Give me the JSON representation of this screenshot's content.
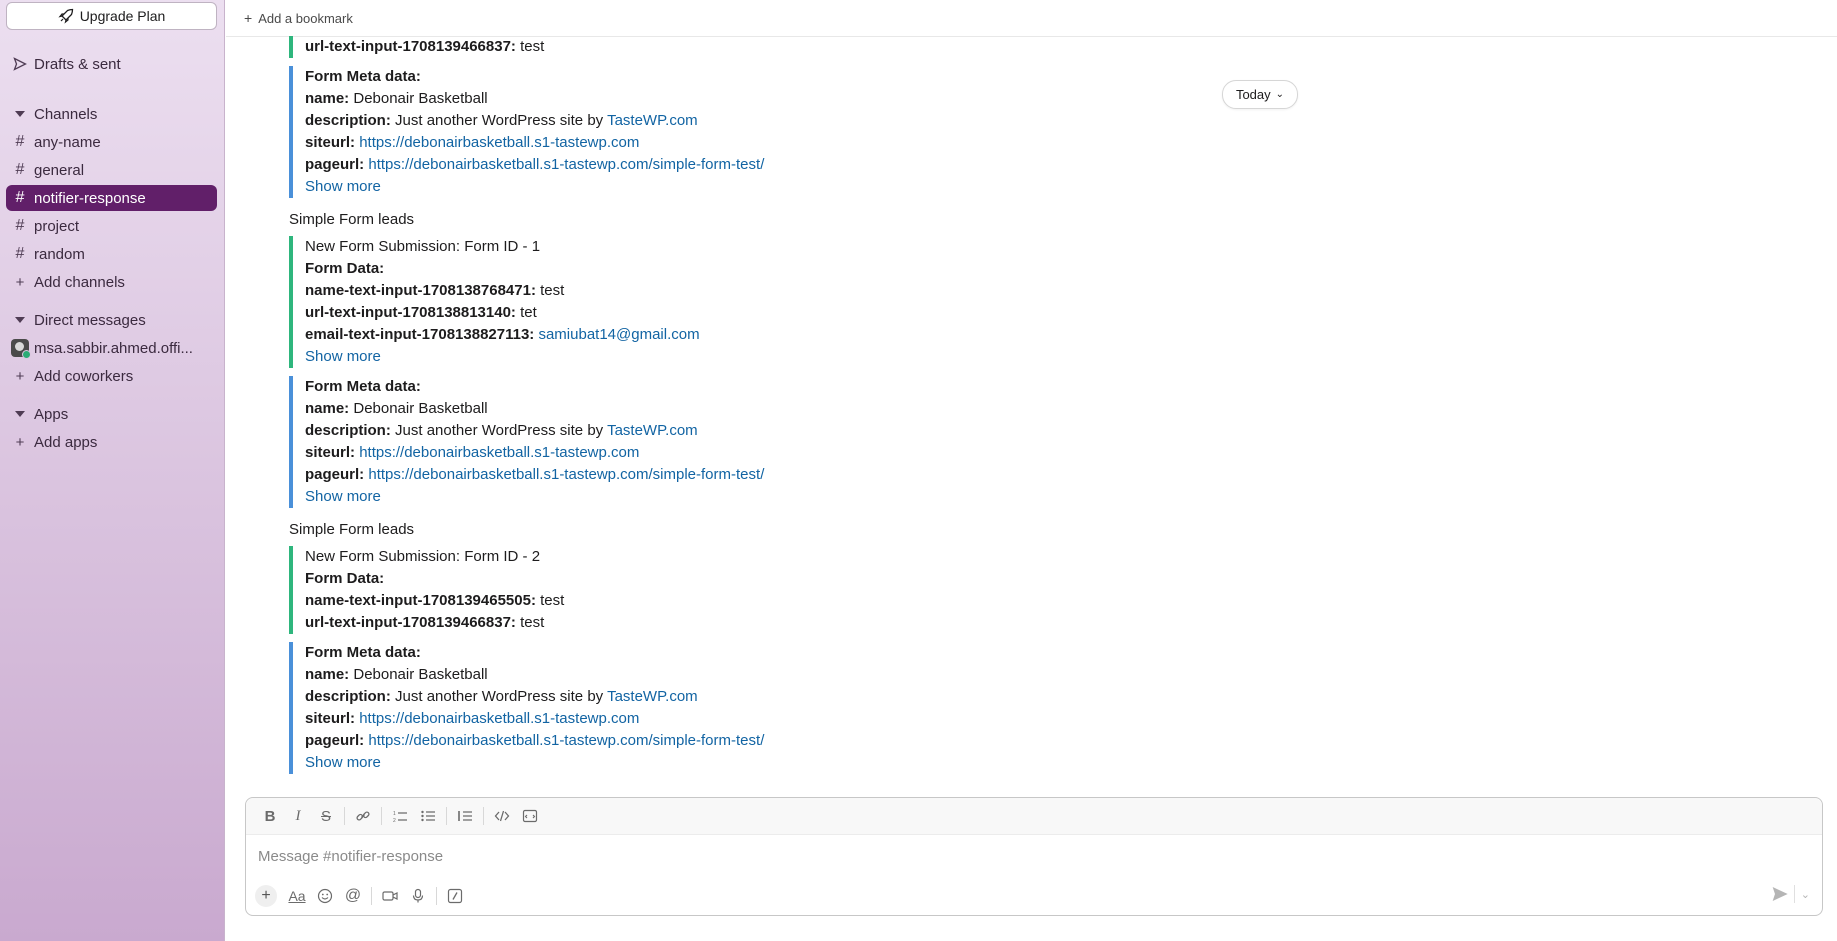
{
  "sidebar": {
    "upgrade_label": "Upgrade Plan",
    "drafts_label": "Drafts & sent",
    "channels_header": "Channels",
    "channels": [
      "any-name",
      "general",
      "notifier-response",
      "project",
      "random"
    ],
    "active_channel": "notifier-response",
    "add_channels": "Add channels",
    "dm_header": "Direct messages",
    "dm_user": "msa.sabbir.ahmed.offi...",
    "add_coworkers": "Add coworkers",
    "apps_header": "Apps",
    "add_apps": "Add apps"
  },
  "topbar": {
    "bookmark_label": "Add a bookmark"
  },
  "date_pill": "Today",
  "messages": {
    "top_partial": {
      "key": "url-text-input-1708139466837:",
      "value": "test"
    },
    "meta_1": {
      "header": "Form Meta data:",
      "name_key": "name:",
      "name_val": "Debonair Basketball",
      "desc_key": "description:",
      "desc_val": "Just another WordPress site by",
      "desc_link": "TasteWP.com",
      "site_key": "siteurl:",
      "site_val": "https://debonairbasketball.s1-tastewp.com",
      "page_key": "pageurl:",
      "page_val": "https://debonairbasketball.s1-tastewp.com/simple-form-test/",
      "show_more": "Show more"
    },
    "post_2": {
      "title": "Simple Form leads",
      "subject": "New Form Submission: Form ID - 1",
      "form_data": "Form Data:",
      "row1_key": "name-text-input-1708138768471:",
      "row1_val": "test",
      "row2_key": "url-text-input-1708138813140:",
      "row2_val": "tet",
      "row3_key": "email-text-input-1708138827113:",
      "row3_val": "samiubat14@gmail.com",
      "show_more": "Show more"
    },
    "meta_2": {
      "header": "Form Meta data:",
      "name_key": "name:",
      "name_val": "Debonair Basketball",
      "desc_key": "description:",
      "desc_val": "Just another WordPress site by",
      "desc_link": "TasteWP.com",
      "site_key": "siteurl:",
      "site_val": "https://debonairbasketball.s1-tastewp.com",
      "page_key": "pageurl:",
      "page_val": "https://debonairbasketball.s1-tastewp.com/simple-form-test/",
      "show_more": "Show more"
    },
    "post_3": {
      "title": "Simple Form leads",
      "subject": "New Form Submission: Form ID - 2",
      "form_data": "Form Data:",
      "row1_key": "name-text-input-1708139465505:",
      "row1_val": "test",
      "row2_key": "url-text-input-1708139466837:",
      "row2_val": "test"
    },
    "meta_3": {
      "header": "Form Meta data:",
      "name_key": "name:",
      "name_val": "Debonair Basketball",
      "desc_key": "description:",
      "desc_val": "Just another WordPress site by",
      "desc_link": "TasteWP.com",
      "site_key": "siteurl:",
      "site_val": "https://debonairbasketball.s1-tastewp.com",
      "page_key": "pageurl:",
      "page_val": "https://debonairbasketball.s1-tastewp.com/simple-form-test/",
      "show_more": "Show more"
    }
  },
  "composer": {
    "placeholder": "Message #notifier-response",
    "toolbar_icons": [
      "bold-icon",
      "italic-icon",
      "strikethrough-icon",
      "link-icon",
      "ordered-list-icon",
      "bulleted-list-icon",
      "blockquote-icon",
      "code-icon",
      "code-block-icon"
    ],
    "bottom_icons": [
      "plus-icon",
      "formatting-icon",
      "emoji-icon",
      "mention-icon",
      "video-icon",
      "microphone-icon",
      "shortcuts-icon",
      "send-icon",
      "schedule-chevron-icon"
    ]
  },
  "colors": {
    "sidebar_active": "#611f69",
    "green_bar": "#2eb67d",
    "blue_bar": "#4a90d9",
    "link": "#1264a3"
  }
}
